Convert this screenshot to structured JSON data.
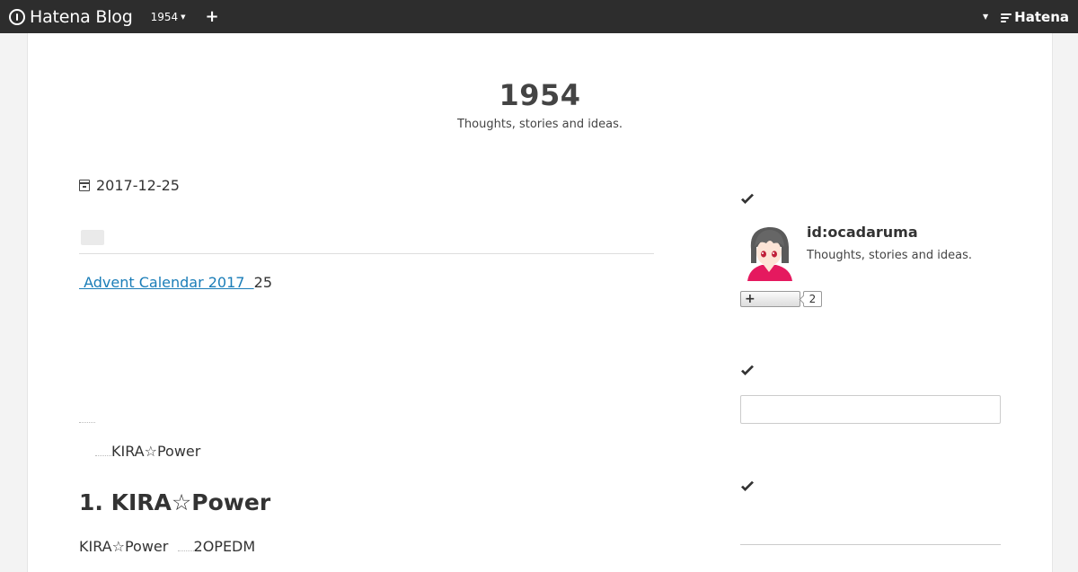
{
  "topbar": {
    "brand": "Hatena Blog",
    "blog_name": "1954",
    "add_icon": "plus-icon",
    "hatena_logo": "Hatena"
  },
  "blog": {
    "title": "1954",
    "description": "Thoughts, stories and ideas."
  },
  "entry": {
    "date": "2017-12-25",
    "link_text": " Advent Calendar 2017  ",
    "line1_suffix": "25",
    "line2_text": "KIRA☆Power",
    "heading": "1. KIRA☆Power",
    "line3_prefix": "KIRA☆Power",
    "line3_suffix": "2OPEDM"
  },
  "sidebar": {
    "profile": {
      "id": "id:ocadaruma",
      "description": "Thoughts, stories and ideas.",
      "follow_icon": "+",
      "follow_count": "2"
    },
    "search": {
      "placeholder": ""
    }
  },
  "colors": {
    "topbar_bg": "#2d2d2d",
    "link": "#1a7db8",
    "page_bg": "#f3f3f3"
  }
}
